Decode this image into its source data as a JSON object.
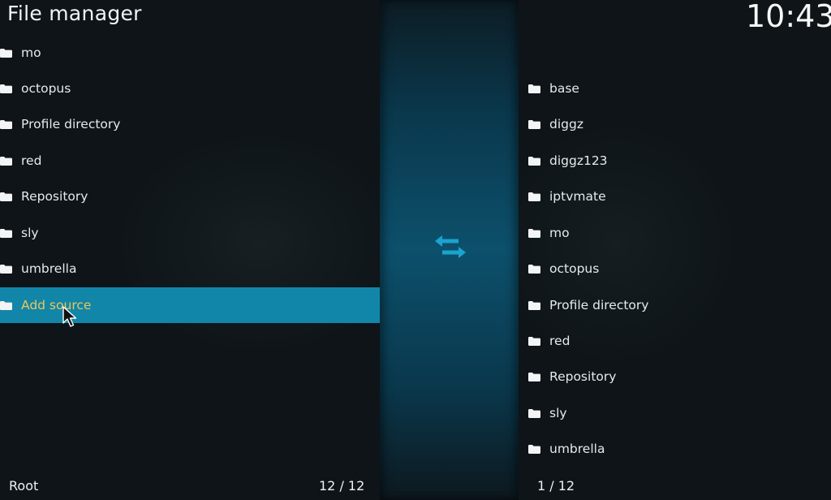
{
  "header": {
    "title": "File manager",
    "clock": "10:43"
  },
  "left_pane": {
    "items": [
      {
        "label": "mo",
        "icon": "folder-icon"
      },
      {
        "label": "octopus",
        "icon": "folder-icon"
      },
      {
        "label": "Profile directory",
        "icon": "folder-icon"
      },
      {
        "label": "red",
        "icon": "folder-icon"
      },
      {
        "label": "Repository",
        "icon": "folder-icon"
      },
      {
        "label": "sly",
        "icon": "folder-icon"
      },
      {
        "label": "umbrella",
        "icon": "folder-icon"
      },
      {
        "label": "Add source",
        "icon": "folder-icon",
        "selected": true
      }
    ],
    "footer_path": "Root",
    "footer_count": "12 / 12"
  },
  "right_pane": {
    "items": [
      {
        "label": "base",
        "icon": "folder-icon"
      },
      {
        "label": "diggz",
        "icon": "folder-icon"
      },
      {
        "label": "diggz123",
        "icon": "folder-icon"
      },
      {
        "label": "iptvmate",
        "icon": "folder-icon"
      },
      {
        "label": "mo",
        "icon": "folder-icon"
      },
      {
        "label": "octopus",
        "icon": "folder-icon"
      },
      {
        "label": "Profile directory",
        "icon": "folder-icon"
      },
      {
        "label": "red",
        "icon": "folder-icon"
      },
      {
        "label": "Repository",
        "icon": "folder-icon"
      },
      {
        "label": "sly",
        "icon": "folder-icon"
      },
      {
        "label": "umbrella",
        "icon": "folder-icon"
      }
    ],
    "footer_count": "1 / 12"
  },
  "colors": {
    "selection": "#1286a8",
    "selected_text": "#e9c65b",
    "accent_icon": "#1aa3cf",
    "background": "#0e1418"
  },
  "icons": {
    "swap": "swap-arrows-icon",
    "cursor": "mouse-pointer-icon"
  }
}
